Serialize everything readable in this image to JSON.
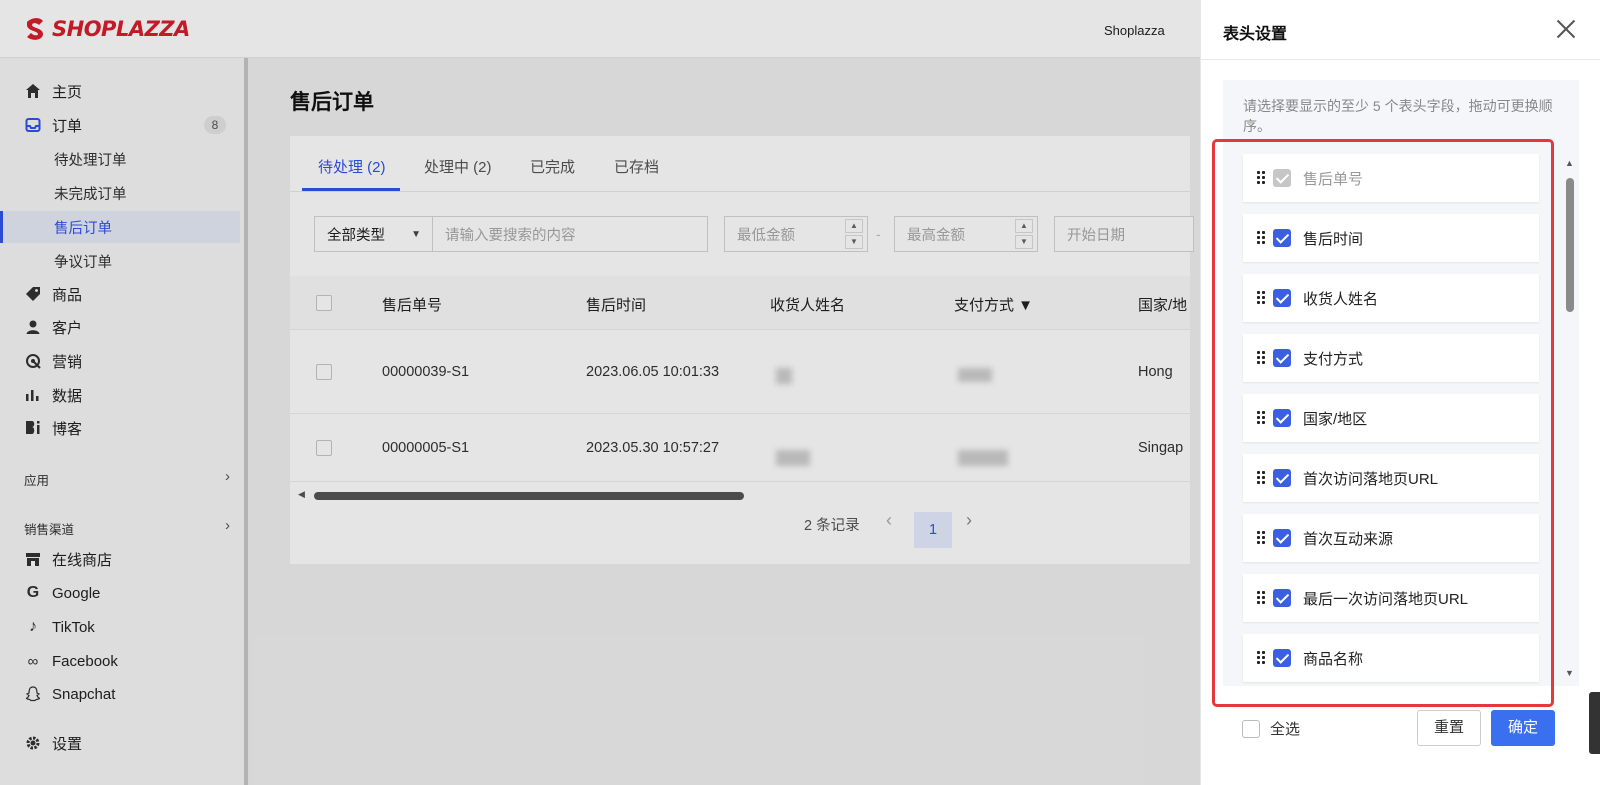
{
  "brand": {
    "logo_text": "SHOPLAZZA",
    "store_name": "Shoplazza"
  },
  "sidebar": {
    "items": [
      {
        "label": "主页",
        "icon": "home-icon"
      },
      {
        "label": "订单",
        "icon": "inbox-icon",
        "badge": "8"
      },
      {
        "label": "商品",
        "icon": "tag-icon"
      },
      {
        "label": "客户",
        "icon": "user-icon"
      },
      {
        "label": "营销",
        "icon": "target-icon"
      },
      {
        "label": "数据",
        "icon": "bar-chart-icon"
      },
      {
        "label": "博客",
        "icon": "blog-icon"
      }
    ],
    "order_subitems": [
      "待处理订单",
      "未完成订单",
      "售后订单",
      "争议订单"
    ],
    "sections": {
      "apps": "应用",
      "channels": "销售渠道"
    },
    "channels": [
      {
        "label": "在线商店",
        "icon": "store-icon"
      },
      {
        "label": "Google",
        "icon": "google-icon"
      },
      {
        "label": "TikTok",
        "icon": "tiktok-icon"
      },
      {
        "label": "Facebook",
        "icon": "meta-icon"
      },
      {
        "label": "Snapchat",
        "icon": "snapchat-icon"
      }
    ],
    "settings": "设置"
  },
  "main": {
    "title": "售后订单",
    "tabs": [
      "待处理 (2)",
      "处理中 (2)",
      "已完成",
      "已存档"
    ],
    "filters": {
      "type": "全部类型",
      "search_placeholder": "请输入要搜索的内容",
      "min_amount": "最低金额",
      "max_amount": "最高金额",
      "start_date": "开始日期"
    },
    "columns": [
      "售后单号",
      "售后时间",
      "收货人姓名",
      "支付方式 ▼",
      "国家/地"
    ],
    "rows": [
      {
        "id": "00000039-S1",
        "time": "2023.06.05 10:01:33",
        "country": "Hong"
      },
      {
        "id": "00000005-S1",
        "time": "2023.05.30 10:57:27",
        "country": "Singap"
      }
    ],
    "pager": {
      "total": "2 条记录",
      "page": "1"
    }
  },
  "drawer": {
    "title": "表头设置",
    "hint": "请选择要显示的至少 5 个表头字段，拖动可更换顺序。",
    "fields": [
      {
        "label": "售后单号",
        "disabled": true
      },
      {
        "label": "售后时间"
      },
      {
        "label": "收货人姓名"
      },
      {
        "label": "支付方式"
      },
      {
        "label": "国家/地区"
      },
      {
        "label": "首次访问落地页URL"
      },
      {
        "label": "首次互动来源"
      },
      {
        "label": "最后一次访问落地页URL"
      },
      {
        "label": "商品名称"
      }
    ],
    "select_all": "全选",
    "reset": "重置",
    "confirm": "确定"
  },
  "colors": {
    "primary": "#3a6ff0",
    "highlight_border": "#e5383b",
    "brand_red": "#d81e2b"
  }
}
